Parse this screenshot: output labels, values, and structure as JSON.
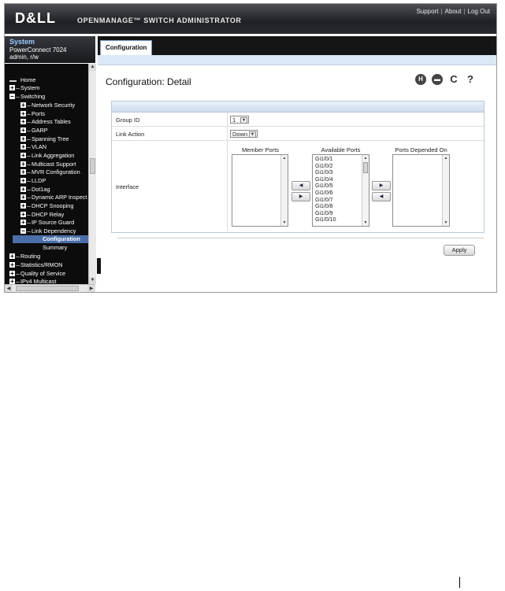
{
  "header": {
    "logo": "D&LL",
    "app_title": "OPENMANAGE™ SWITCH ADMINISTRATOR",
    "links": [
      "Support",
      "About",
      "Log Out"
    ]
  },
  "system": {
    "title": "System",
    "model": "PowerConnect 7024",
    "user": "admin, r/w"
  },
  "tree": [
    {
      "label": "Home",
      "level": 0,
      "toggle": "none"
    },
    {
      "label": "System",
      "level": 0,
      "toggle": "plus"
    },
    {
      "label": "Switching",
      "level": 0,
      "toggle": "minus"
    },
    {
      "label": "Network Security",
      "level": 1,
      "toggle": "plus"
    },
    {
      "label": "Ports",
      "level": 1,
      "toggle": "plus"
    },
    {
      "label": "Address Tables",
      "level": 1,
      "toggle": "plus"
    },
    {
      "label": "GARP",
      "level": 1,
      "toggle": "plus"
    },
    {
      "label": "Spanning Tree",
      "level": 1,
      "toggle": "plus"
    },
    {
      "label": "VLAN",
      "level": 1,
      "toggle": "plus"
    },
    {
      "label": "Link Aggregation",
      "level": 1,
      "toggle": "plus"
    },
    {
      "label": "Multicast Support",
      "level": 1,
      "toggle": "plus"
    },
    {
      "label": "MVR Configuration",
      "level": 1,
      "toggle": "plus"
    },
    {
      "label": "LLDP",
      "level": 1,
      "toggle": "plus"
    },
    {
      "label": "Dot1ag",
      "level": 1,
      "toggle": "plus"
    },
    {
      "label": "Dynamic ARP Inspect",
      "level": 1,
      "toggle": "plus"
    },
    {
      "label": "DHCP Snooping",
      "level": 1,
      "toggle": "plus"
    },
    {
      "label": "DHCP Relay",
      "level": 1,
      "toggle": "plus"
    },
    {
      "label": "IP Source Guard",
      "level": 1,
      "toggle": "plus"
    },
    {
      "label": "Link Dependency",
      "level": 1,
      "toggle": "minus"
    },
    {
      "label": "Configuration",
      "level": 2,
      "toggle": "none",
      "selected": true
    },
    {
      "label": "Summary",
      "level": 2,
      "toggle": "none"
    },
    {
      "label": "Routing",
      "level": 0,
      "toggle": "plus"
    },
    {
      "label": "Statistics/RMON",
      "level": 0,
      "toggle": "plus"
    },
    {
      "label": "Quality of Service",
      "level": 0,
      "toggle": "plus"
    },
    {
      "label": "IPv4 Multicast",
      "level": 0,
      "toggle": "plus"
    }
  ],
  "tab": {
    "label": "Configuration"
  },
  "page": {
    "title": "Configuration: Detail",
    "icons": [
      "save-icon",
      "print-icon",
      "refresh-icon",
      "help-icon"
    ]
  },
  "form": {
    "group_id": {
      "label": "Group ID",
      "value": "1"
    },
    "link_action": {
      "label": "Link Action",
      "value": "Down"
    },
    "interface": {
      "label": "Interface"
    },
    "member_ports": {
      "title": "Member Ports",
      "items": []
    },
    "available_ports": {
      "title": "Available Ports",
      "items": [
        "Gi1/0/1",
        "Gi1/0/2",
        "Gi1/0/3",
        "Gi1/0/4",
        "Gi1/0/5",
        "Gi1/0/6",
        "Gi1/0/7",
        "Gi1/0/8",
        "Gi1/0/9",
        "Gi1/0/10"
      ]
    },
    "ports_depended_on": {
      "title": "Ports Depended On",
      "items": []
    }
  },
  "apply_label": "Apply"
}
